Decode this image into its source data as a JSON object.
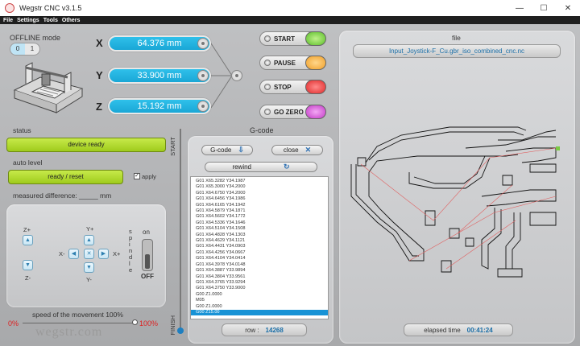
{
  "window": {
    "title": "Wegstr CNC  v3.1.5",
    "minimize": "—",
    "maximize": "☐",
    "close": "✕"
  },
  "menu": [
    "File",
    "Settings",
    "Tools",
    "Others"
  ],
  "offline": {
    "label": "OFFLINE mode",
    "toggle_on": "0",
    "toggle_off": "1"
  },
  "axes": [
    {
      "name": "X",
      "value": "64.376 mm"
    },
    {
      "name": "Y",
      "value": "33.900 mm"
    },
    {
      "name": "Z",
      "value": "15.192 mm"
    }
  ],
  "actions": [
    {
      "label": "START",
      "color": "#5bbf2a"
    },
    {
      "label": "PAUSE",
      "color": "#f0a02a"
    },
    {
      "label": "STOP",
      "color": "#e02a2a"
    },
    {
      "label": "GO ZERO",
      "color": "#c33ac6"
    }
  ],
  "status": {
    "label": "status",
    "value": "device ready"
  },
  "auto_level": {
    "label": "auto level",
    "button": "ready / reset",
    "apply_label": "apply",
    "apply_checked": "✓",
    "measured_label": "measured difference:  _____  mm"
  },
  "jog": {
    "z_plus": "Z+",
    "z_minus": "Z-",
    "y_plus": "Y+",
    "y_minus": "Y-",
    "x_plus": "X+",
    "x_minus": "X-",
    "spindle_label": "s p i n d l e",
    "spindle_on": "on",
    "spindle_off": "OFF"
  },
  "speed": {
    "label": "speed of the movement 100%",
    "min": "0%",
    "max": "100%",
    "level": 1.0,
    "watermark": "wegstr.com"
  },
  "progress": {
    "start": "START",
    "finish": "FINISH"
  },
  "gcode": {
    "title": "G-code",
    "gcode_btn": "G-code",
    "close_btn": "close",
    "rewind_btn": "rewind",
    "lines": [
      "G01 X65.3282 Y34.1987",
      "G01 X65.3000 Y34.2000",
      "G01 X64.6750 Y34.2000",
      "G01 X64.6456 Y34.1986",
      "G01 X64.6165 Y34.1942",
      "G01 X64.5879 Y34.1871",
      "G01 X64.5602 Y34.1772",
      "G01 X64.5336 Y34.1646",
      "G01 X64.5104 Y34.1508",
      "G01 X64.4828 Y34.1303",
      "G01 X64.4629 Y34.1121",
      "G01 X64.4431 Y34.0903",
      "G01 X64.4256 Y34.0667",
      "G01 X64.4104 Y34.0414",
      "G01 X64.3978 Y34.0148",
      "G01 X64.3887 Y33.9894",
      "G01 X64.3804 Y33.9561",
      "G01 X64.3765 Y33.9294",
      "G01 X64.3750 Y33.9000",
      "G00 Z1.0000",
      "M05",
      "G00 Z1.0000",
      "G00 Z15.00"
    ],
    "row_label": "row :",
    "row_value": "14268"
  },
  "file": {
    "title": "file",
    "name": "Input_Joystick-F_Cu.gbr_iso_combined_cnc.nc",
    "elapsed_label": "elapsed time",
    "elapsed_value": "00:41:24"
  }
}
